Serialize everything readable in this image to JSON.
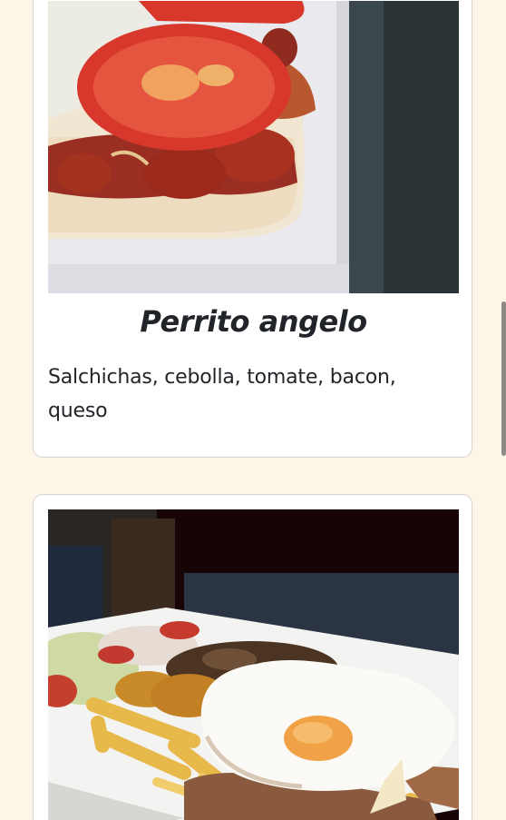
{
  "menu": {
    "items": [
      {
        "title": "Perrito angelo",
        "description": "Salchichas, cebolla, tomate, bacon, queso",
        "image_subject": "hot dog with sausages, tomato, bacon and onion"
      },
      {
        "title": "",
        "description": "",
        "image_subject": "plate with fried egg, steak, french fries, croquettes, mushrooms and salad"
      }
    ]
  },
  "colors": {
    "page_background": "#fdf5e8",
    "card_background": "#ffffff",
    "card_border": "#d6d3cf",
    "text": "#212529"
  }
}
